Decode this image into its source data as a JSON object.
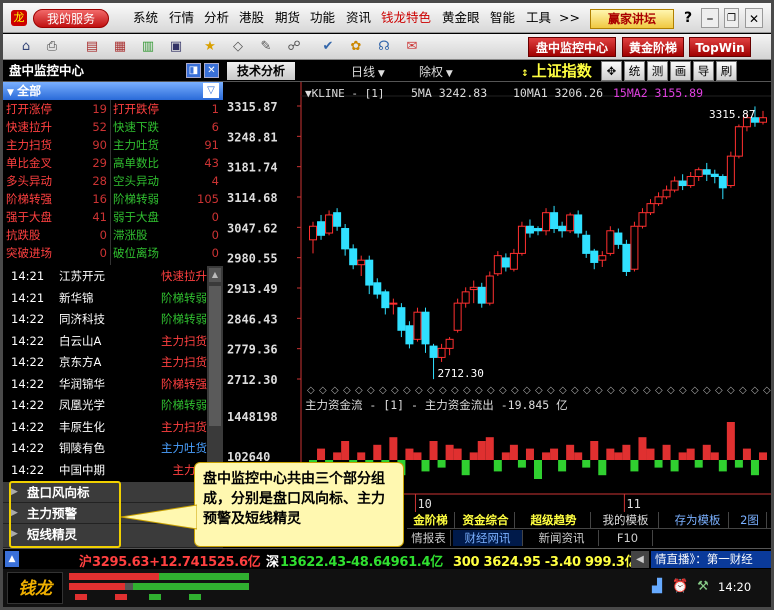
{
  "menubar": {
    "service_label": "我的服务",
    "items": [
      "系统",
      "行情",
      "分析",
      "港股",
      "期货",
      "功能",
      "资讯",
      "钱龙特色",
      "黄金眼",
      "智能",
      "工具",
      ">>"
    ],
    "forum_label": "赢家讲坛",
    "help": "?",
    "minimize": "–",
    "close": "✕"
  },
  "toolbar": {
    "monitor_btn": "盘中监控中心",
    "gold_btn": "黄金阶梯",
    "topwin_btn": "TopWin"
  },
  "left_panel": {
    "title": "盘中监控中心",
    "all_label": "全部",
    "stats": [
      {
        "l": "打开涨停",
        "lv": "19",
        "r": "打开跌停",
        "rv": "1"
      },
      {
        "l": "快速拉升",
        "lv": "52",
        "r": "快速下跌",
        "rv": "6"
      },
      {
        "l": "主力扫货",
        "lv": "90",
        "r": "主力吐货",
        "rv": "91"
      },
      {
        "l": "单比金叉",
        "lv": "29",
        "r": "高单数比",
        "rv": "43"
      },
      {
        "l": "多头异动",
        "lv": "28",
        "r": "空头异动",
        "rv": "4"
      },
      {
        "l": "阶梯转强",
        "lv": "16",
        "r": "阶梯转弱",
        "rv": "105"
      },
      {
        "l": "强于大盘",
        "lv": "41",
        "r": "弱于大盘",
        "rv": "0"
      },
      {
        "l": "抗跌股",
        "lv": "0",
        "r": "滞涨股",
        "rv": "0"
      },
      {
        "l": "突破进场",
        "lv": "0",
        "r": "破位离场",
        "rv": "0"
      }
    ],
    "alerts": [
      {
        "time": "14:21",
        "name": "江苏开元",
        "kind": "快速拉升",
        "color": "#ff4040"
      },
      {
        "time": "14:21",
        "name": "新华锦",
        "kind": "阶梯转弱",
        "color": "#30c030"
      },
      {
        "time": "14:22",
        "name": "同济科技",
        "kind": "阶梯转弱",
        "color": "#30c030"
      },
      {
        "time": "14:22",
        "name": "白云山A",
        "kind": "主力扫货",
        "color": "#ff4040"
      },
      {
        "time": "14:22",
        "name": "京东方A",
        "kind": "主力扫货",
        "color": "#ff4040"
      },
      {
        "time": "14:22",
        "name": "华润锦华",
        "kind": "阶梯转强",
        "color": "#ff4040"
      },
      {
        "time": "14:22",
        "name": "凤凰光学",
        "kind": "阶梯转弱",
        "color": "#30c030"
      },
      {
        "time": "14:22",
        "name": "丰原生化",
        "kind": "主力扫货",
        "color": "#ff4040"
      },
      {
        "time": "14:22",
        "name": "铜陵有色",
        "kind": "主力吐货",
        "color": "#4aa0ff"
      },
      {
        "time": "14:22",
        "name": "中国中期",
        "kind": "主力扫",
        "color": "#ff4040"
      }
    ],
    "sections": [
      "盘口风向标",
      "主力预警",
      "短线精灵"
    ]
  },
  "chart_header": {
    "tech_label": "技术分析",
    "period": "日线",
    "adjust": "除权",
    "index_name": "上证指数",
    "tools": [
      "✥",
      "统",
      "测",
      "画",
      "导",
      "刷"
    ]
  },
  "chart_data": {
    "type": "candlestick",
    "title": "上证指数",
    "legend": {
      "kline": "KLINE - [1]",
      "ma5": "5MA 3242.83",
      "ma10": "10MA1 3206.26",
      "ma15": "15MA2 3155.89"
    },
    "y_ticks": [
      "3315.87",
      "3248.81",
      "3181.74",
      "3114.68",
      "3047.62",
      "2980.55",
      "2913.49",
      "2846.43",
      "2779.36",
      "2712.30"
    ],
    "ylim": [
      2712.3,
      3315.87
    ],
    "high_label": "3315.87",
    "low_label": "2712.30",
    "x_labels": [
      "10",
      "11"
    ],
    "candles": [
      [
        3020,
        3050,
        2990,
        3060
      ],
      [
        3060,
        3030,
        3020,
        3075
      ],
      [
        3035,
        3075,
        3030,
        3085
      ],
      [
        3080,
        3050,
        3040,
        3090
      ],
      [
        3045,
        3000,
        2985,
        3055
      ],
      [
        3000,
        2965,
        2955,
        3010
      ],
      [
        2965,
        2975,
        2940,
        2985
      ],
      [
        2975,
        2920,
        2900,
        2985
      ],
      [
        2925,
        2900,
        2890,
        2935
      ],
      [
        2905,
        2870,
        2855,
        2910
      ],
      [
        2880,
        2880,
        2855,
        2890
      ],
      [
        2870,
        2820,
        2805,
        2880
      ],
      [
        2830,
        2790,
        2780,
        2840
      ],
      [
        2800,
        2860,
        2795,
        2870
      ],
      [
        2860,
        2790,
        2770,
        2870
      ],
      [
        2785,
        2760,
        2712,
        2790
      ],
      [
        2760,
        2780,
        2750,
        2790
      ],
      [
        2780,
        2800,
        2765,
        2805
      ],
      [
        2820,
        2880,
        2815,
        2890
      ],
      [
        2880,
        2905,
        2870,
        2915
      ],
      [
        2910,
        2915,
        2880,
        2930
      ],
      [
        2915,
        2880,
        2870,
        2925
      ],
      [
        2880,
        2940,
        2875,
        2950
      ],
      [
        2945,
        2985,
        2940,
        2995
      ],
      [
        2980,
        2960,
        2950,
        2990
      ],
      [
        2955,
        2990,
        2950,
        3000
      ],
      [
        2990,
        3050,
        2985,
        3060
      ],
      [
        3050,
        3035,
        3025,
        3065
      ],
      [
        3045,
        3040,
        3030,
        3050
      ],
      [
        3040,
        3080,
        3030,
        3090
      ],
      [
        3080,
        3045,
        3035,
        3095
      ],
      [
        3050,
        3040,
        3025,
        3060
      ],
      [
        3040,
        3075,
        3035,
        3080
      ],
      [
        3075,
        3035,
        3025,
        3085
      ],
      [
        3030,
        2990,
        2980,
        3040
      ],
      [
        2995,
        2970,
        2955,
        3000
      ],
      [
        2975,
        2985,
        2960,
        2995
      ],
      [
        2990,
        3040,
        2985,
        3050
      ],
      [
        3035,
        3010,
        3000,
        3045
      ],
      [
        3010,
        2950,
        2940,
        3020
      ],
      [
        2955,
        3050,
        2950,
        3060
      ],
      [
        3050,
        3080,
        3045,
        3090
      ],
      [
        3080,
        3100,
        3075,
        3110
      ],
      [
        3100,
        3115,
        3095,
        3125
      ],
      [
        3115,
        3130,
        3110,
        3140
      ],
      [
        3130,
        3150,
        3125,
        3160
      ],
      [
        3150,
        3140,
        3130,
        3165
      ],
      [
        3140,
        3160,
        3135,
        3170
      ],
      [
        3160,
        3175,
        3150,
        3180
      ],
      [
        3175,
        3165,
        3150,
        3190
      ],
      [
        3165,
        3160,
        3145,
        3175
      ],
      [
        3160,
        3135,
        3110,
        3165
      ],
      [
        3140,
        3205,
        3135,
        3215
      ],
      [
        3205,
        3270,
        3200,
        3275
      ],
      [
        3270,
        3290,
        3260,
        3300
      ],
      [
        3290,
        3280,
        3270,
        3315
      ],
      [
        3280,
        3290,
        3275,
        3305
      ]
    ],
    "flow_title": "主力资金流 - [1] - 主力资金流出 -19.845 亿",
    "flow_ticks": [
      "1448198",
      "102640"
    ],
    "flow_values": [
      -0.2,
      0.3,
      -0.4,
      0.2,
      0.5,
      -0.3,
      0.2,
      -0.5,
      0.4,
      -0.2,
      0.6,
      -0.4,
      0.3,
      0.2,
      -0.3,
      0.5,
      -0.2,
      0.4,
      0.3,
      -0.4,
      0.2,
      0.5,
      0.6,
      -0.3,
      0.2,
      0.4,
      -0.2,
      0.3,
      -0.5,
      0.2,
      0.3,
      -0.3,
      0.4,
      0.2,
      -0.2,
      0.5,
      -0.4,
      0.3,
      0.2,
      0.4,
      -0.3,
      0.6,
      0.3,
      -0.2,
      0.4,
      -0.3,
      0.2,
      0.3,
      -0.2,
      0.4,
      0.2,
      -0.3,
      1.0,
      -0.2,
      0.3,
      -0.4,
      0.2
    ]
  },
  "callout": {
    "text": "盘中监控中心共由三个部分组成，分别是盘口风向标、主力预警及短线精灵"
  },
  "tabs1": [
    "金阶梯",
    "资金综合",
    "超级趋势",
    "我的模板",
    "存为模板",
    "2图"
  ],
  "tabs2": [
    "情报表",
    "财经网讯",
    "新闻资讯",
    "F10"
  ],
  "statusbar": {
    "sh_label": "沪",
    "sh_value": "3295.63+12.741525.6亿",
    "sz_label": "深",
    "sz_value": "13622.43-48.64961.4亿",
    "hs300_value": "300 3624.95 -3.40 999.3亿",
    "news": "情直播》：第一财经"
  },
  "footer": {
    "logo": "钱龙",
    "time": "14:20"
  }
}
